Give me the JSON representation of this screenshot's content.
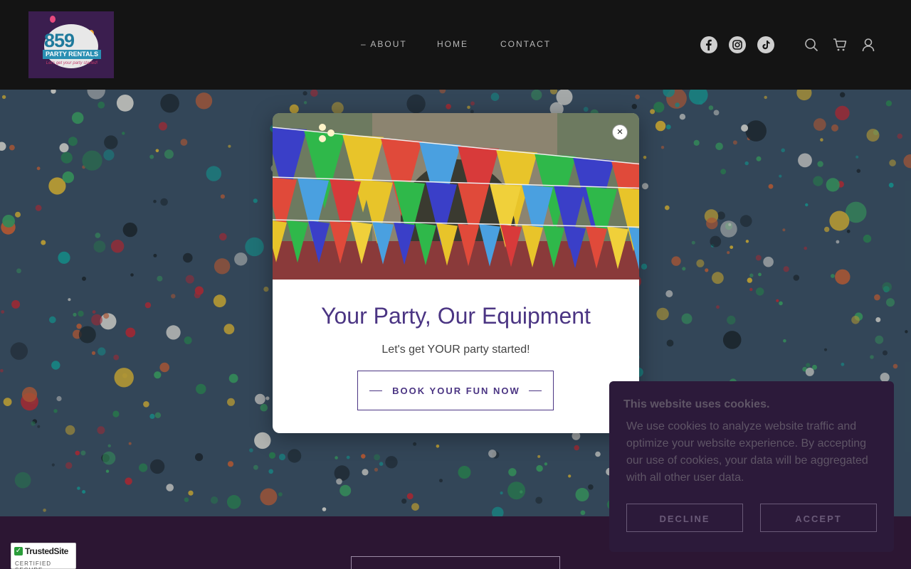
{
  "header": {
    "logo": {
      "number": "859",
      "subtitle": "PARTY RENTALS",
      "tagline": "Let's get your party started!"
    },
    "nav": [
      {
        "label": "– ABOUT"
      },
      {
        "label": "HOME"
      },
      {
        "label": "CONTACT"
      }
    ],
    "social_icons": [
      "facebook-icon",
      "instagram-icon",
      "tiktok-icon"
    ],
    "utility_icons": [
      "search-icon",
      "cart-icon",
      "account-icon"
    ]
  },
  "modal": {
    "title": "Your Party, Our Equipment",
    "text": "Let's get YOUR party started!",
    "cta_label": "BOOK YOUR FUN NOW",
    "close_icon": "close-icon"
  },
  "cookie": {
    "title": "This website uses cookies.",
    "body": "We use cookies to analyze website traffic and optimize your website experience. By accepting our use of cookies, your data will be aggregated with all other user data.",
    "decline_label": "DECLINE",
    "accept_label": "ACCEPT"
  },
  "badge": {
    "title": "TrustedSite",
    "subtitle": "CERTIFIED SECURE"
  },
  "colors": {
    "header_bg": "#141414",
    "brand_purple": "#4b3583",
    "cookie_bg": "#2c1a3a",
    "footer_bg": "#2c1633"
  }
}
